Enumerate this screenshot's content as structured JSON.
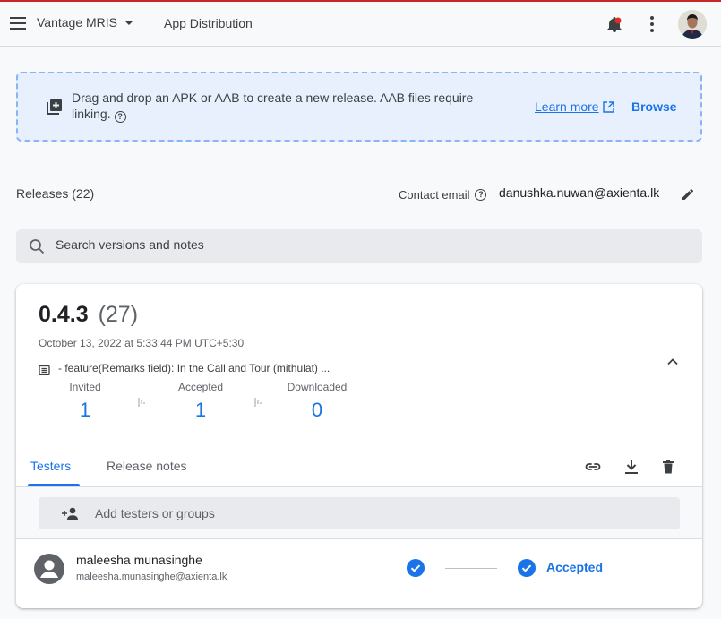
{
  "topbar": {
    "project_name": "Vantage MRIS",
    "section_title": "App Distribution",
    "icons": [
      "menu-icon",
      "notifications-icon",
      "more-vert-icon",
      "avatar"
    ]
  },
  "dropzone": {
    "text": "Drag and drop an APK or AAB to create a new release. AAB files require linking.",
    "learn_more": "Learn more",
    "browse": "Browse"
  },
  "releases": {
    "count_label": "Releases (22)",
    "contact_label": "Contact email",
    "contact_email": "danushka.nuwan@axienta.lk"
  },
  "search": {
    "placeholder": "Search versions and notes"
  },
  "release": {
    "version": "0.4.3",
    "build": "(27)",
    "date": "October 13, 2022 at 5:33:44 PM UTC+5:30",
    "notes_preview": "- feature(Remarks field): In the Call and Tour (mithulat) ...",
    "stats": [
      {
        "label": "Invited",
        "value": "1"
      },
      {
        "label": "Accepted",
        "value": "1"
      },
      {
        "label": "Downloaded",
        "value": "0"
      }
    ]
  },
  "tabs": [
    {
      "label": "Testers",
      "active": true
    },
    {
      "label": "Release notes",
      "active": false
    }
  ],
  "toolbar_icons": [
    "link-icon",
    "download-icon",
    "delete-icon"
  ],
  "add_testers": {
    "placeholder": "Add testers or groups"
  },
  "testers": [
    {
      "name": "maleesha munasinghe",
      "email": "maleesha.munasinghe@axienta.lk",
      "status": "Accepted"
    }
  ],
  "colors": {
    "accent": "#1a73e8",
    "notification_badge": "#d93025",
    "dropzone_bg": "#e8f0fe",
    "top_border": "#c62828"
  }
}
